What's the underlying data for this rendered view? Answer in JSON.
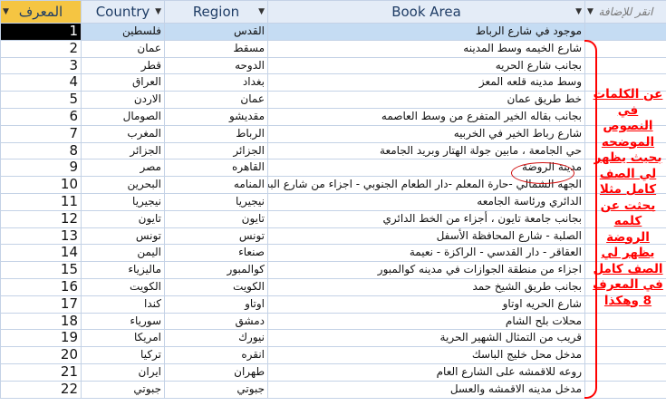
{
  "columns": {
    "id": "المعرف",
    "country": "Country",
    "region": "Region",
    "area": "Book Area",
    "add": "انقر للإضافة"
  },
  "rows": [
    {
      "id": "1",
      "country": "فلسطين",
      "region": "القدس",
      "area": "موجود في شارع الرباط"
    },
    {
      "id": "2",
      "country": "عمان",
      "region": "مسقط",
      "area": "شارع الخيمه وسط المدينه"
    },
    {
      "id": "3",
      "country": "قطر",
      "region": "الدوحه",
      "area": "بجانب شارع الحريه"
    },
    {
      "id": "4",
      "country": "العراق",
      "region": "بغداد",
      "area": "وسط مدينه قلعه المعز"
    },
    {
      "id": "5",
      "country": "الاردن",
      "region": "عمان",
      "area": "خط طريق عمان"
    },
    {
      "id": "6",
      "country": "الصومال",
      "region": "مقديشو",
      "area": "بجانب بقاله الخير المتفرع من وسط العاصمه"
    },
    {
      "id": "7",
      "country": "المغرب",
      "region": "الرباط",
      "area": "شارع رباط الخير في الخربيه"
    },
    {
      "id": "8",
      "country": "الجزائر",
      "region": "الجزائر",
      "area": "حي الجامعة ، مابين جولة الهتار وبريد الجامعة"
    },
    {
      "id": "9",
      "country": "مصر",
      "region": "القاهره",
      "area": "مدينة الروضة"
    },
    {
      "id": "10",
      "country": "البحرين",
      "region": "المنامه",
      "area": "الجهه الشمالي -حارة المعلم -دار الطعام الجنوبي - اجزاء من شارع البحرين"
    },
    {
      "id": "11",
      "country": "نيجيريا",
      "region": "نيجيريا",
      "area": "الدائري ورئاسة الجامعه"
    },
    {
      "id": "12",
      "country": "تايون",
      "region": "تايون",
      "area": "بجانب جامعة تايون ، أجزاء من الخط الدائري"
    },
    {
      "id": "13",
      "country": "تونس",
      "region": "تونس",
      "area": "الصلبة - شارع المحافظة الأسفل"
    },
    {
      "id": "14",
      "country": "اليمن",
      "region": "صنعاء",
      "area": "العقاقر - دار القدسي - الراكزة - نعيمة"
    },
    {
      "id": "15",
      "country": "ماليزياء",
      "region": "كوالمبور",
      "area": "اجزاء من منطقة الجوازات في مدينه كوالمبور"
    },
    {
      "id": "16",
      "country": "الكويت",
      "region": "الكويت",
      "area": "بجانب طريق الشيخ حمد"
    },
    {
      "id": "17",
      "country": "كندا",
      "region": "اوتاو",
      "area": "شارع الحريه اوتاو"
    },
    {
      "id": "18",
      "country": "سورياء",
      "region": "دمشق",
      "area": "محلات بلح الشام"
    },
    {
      "id": "19",
      "country": "امريكا",
      "region": "نيورك",
      "area": "قريب من التمثال الشهير الحرية"
    },
    {
      "id": "20",
      "country": "تركيا",
      "region": "انقره",
      "area": "مدخل محل خليج الباسك"
    },
    {
      "id": "21",
      "country": "ايران",
      "region": "طهران",
      "area": "روعه للاقمشه على الشارع العام"
    },
    {
      "id": "22",
      "country": "جبوتي",
      "region": "جبوتي",
      "area": "مدخل مدينه الاقمشه والعسل"
    }
  ],
  "annotation": "عن الكلمات في النصوص الموضحه بحيث يظهر لي الصف كامل مثلا بحثت عن كلمه الروضة يظهر لي الصف كامل في المعرف 8 وهكذا",
  "colors": {
    "header": "#e4ecf7",
    "selected": "#c5dcf3",
    "annotation": "#ff0000"
  }
}
